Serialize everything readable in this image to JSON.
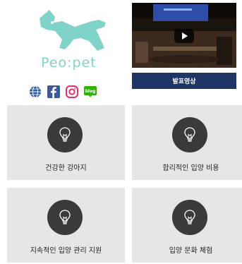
{
  "brand": {
    "logo_text": "Peo:pet"
  },
  "socials": [
    {
      "icon": "globe-icon"
    },
    {
      "icon": "facebook-icon"
    },
    {
      "icon": "instagram-icon"
    },
    {
      "icon": "blog-icon",
      "text": "blog"
    }
  ],
  "video": {
    "caption": "발표영상"
  },
  "cards": [
    {
      "label": "건강한 강아지",
      "icon": "lightbulb-icon"
    },
    {
      "label": "합리적인 입양 비용",
      "icon": "lightbulb-icon"
    },
    {
      "label": "지속적인 입양 관리 지원",
      "icon": "lightbulb-icon"
    },
    {
      "label": "입양 문화 체험",
      "icon": "lightbulb-icon"
    }
  ],
  "colors": {
    "brand": "#7fd3c8",
    "caption_bar": "#1f3565",
    "card_bg": "#e6e6e6",
    "circle": "#3a3a3a"
  }
}
